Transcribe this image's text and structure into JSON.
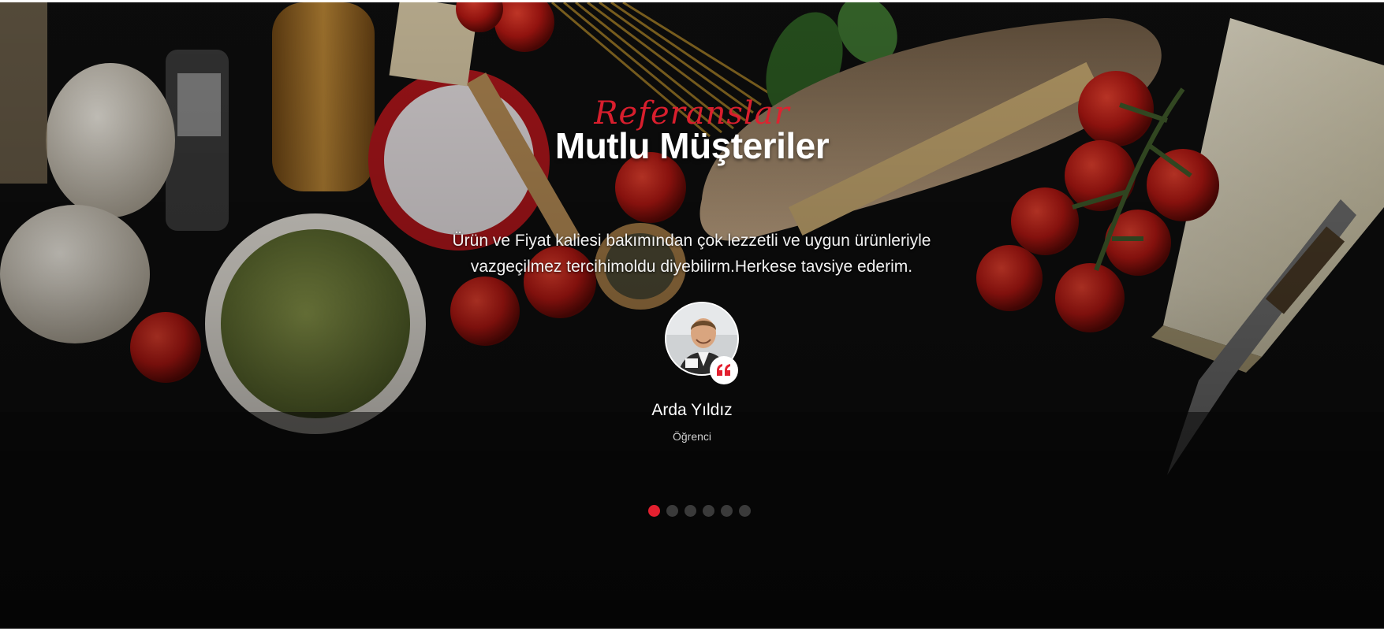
{
  "section": {
    "script_title": "Referanslar",
    "title": "Mutlu Müşteriler"
  },
  "testimonial": {
    "quote": "Ürün ve Fiyat kaliesi bakımından çok lezzetli ve uygun ürünleriyle vazgeçilmez tercihimoldu diyebilirm.Herkese tavsiye ederim.",
    "name": "Arda Yıldız",
    "role": "Öğrenci",
    "badge_icon": "quote-icon"
  },
  "slider": {
    "total_slides": 6,
    "active_index": 0
  },
  "colors": {
    "accent": "#e3202f",
    "background": "#0b0b0b",
    "inactive_dot": "#3a3a3a"
  }
}
